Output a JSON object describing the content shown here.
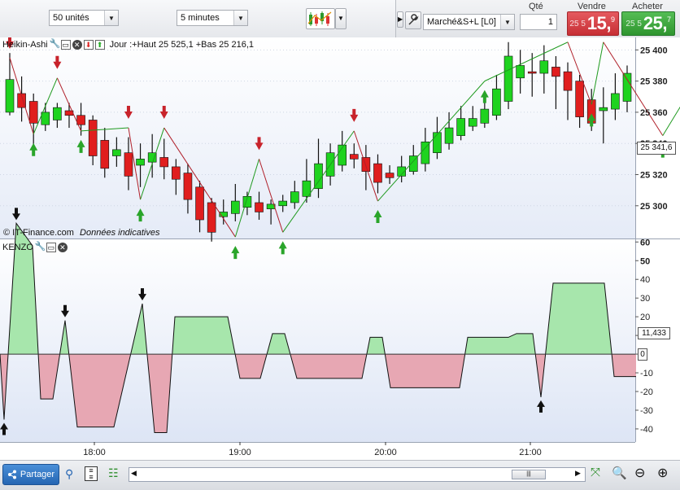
{
  "toolbar": {
    "quantity_select": "50 unités",
    "timeframe_select": "5 minutes",
    "qty_label": "Qté",
    "qty_value": "1",
    "sell_label": "Vendre",
    "buy_label": "Acheter",
    "order_type_select": "Marché&S+L [L0]",
    "sell_price_small": "25 5",
    "sell_price_big": "15,",
    "sell_price_sup": "9",
    "buy_price_small": "25 5",
    "buy_price_big": "25,",
    "buy_price_sup": "7",
    "colors": {
      "sell": "#d8393f",
      "buy": "#3aa63a"
    }
  },
  "price_panel": {
    "indicator_name": "Heikin-Ashi",
    "day_info": "Jour :+Haut 25 525,1 +Bas 25 216,1",
    "copyright": "© IT-Finance.com",
    "disclaimer": "Données indicatives",
    "current_price_label": "25 341,6"
  },
  "indicator_panel": {
    "name": "KENZO",
    "current_value_label": "11,433",
    "zero_label": "0"
  },
  "bottom": {
    "share_button": "Partager"
  },
  "chart_data": [
    {
      "type": "candlestick",
      "title": "Heikin-Ashi",
      "x_ticks": [
        "18:00",
        "19:00",
        "20:00",
        "21:00"
      ],
      "y_ticks": [
        25300,
        25320,
        25340,
        25360,
        25380,
        25400
      ],
      "ylim": [
        25279,
        25408
      ],
      "candles": [
        [
          25360,
          25381,
          25358,
          25398
        ],
        [
          25372,
          25363,
          25354,
          25383
        ],
        [
          25367,
          25353,
          25335,
          25372
        ],
        [
          25352,
          25360,
          25348,
          25366
        ],
        [
          25355,
          25363,
          25350,
          25366
        ],
        [
          25361,
          25358,
          25350,
          25366
        ],
        [
          25358,
          25352,
          25345,
          25366
        ],
        [
          25355,
          25332,
          25326,
          25358
        ],
        [
          25342,
          25324,
          25318,
          25350
        ],
        [
          25332,
          25336,
          25325,
          25344
        ],
        [
          25334,
          25319,
          25310,
          25344
        ],
        [
          25326,
          25330,
          25312,
          25340
        ],
        [
          25328,
          25334,
          25318,
          25346
        ],
        [
          25331,
          25325,
          25317,
          25343
        ],
        [
          25325,
          25317,
          25307,
          25330
        ],
        [
          25321,
          25304,
          25295,
          25327
        ],
        [
          25312,
          25291,
          25283,
          25316
        ],
        [
          25302,
          25283,
          25277,
          25305
        ],
        [
          25293,
          25296,
          25288,
          25304
        ],
        [
          25295,
          25303,
          25290,
          25314
        ],
        [
          25299,
          25306,
          25294,
          25309
        ],
        [
          25302,
          25296,
          25291,
          25309
        ],
        [
          25298,
          25301,
          25288,
          25304
        ],
        [
          25300,
          25303,
          25296,
          25307
        ],
        [
          25302,
          25309,
          25298,
          25316
        ],
        [
          25306,
          25316,
          25302,
          25330
        ],
        [
          25311,
          25327,
          25305,
          25343
        ],
        [
          25319,
          25334,
          25313,
          25340
        ],
        [
          25326,
          25339,
          25322,
          25348
        ],
        [
          25333,
          25330,
          25324,
          25340
        ],
        [
          25331,
          25322,
          25310,
          25339
        ],
        [
          25327,
          25315,
          25308,
          25333
        ],
        [
          25321,
          25318,
          25314,
          25326
        ],
        [
          25319,
          25325,
          25315,
          25332
        ],
        [
          25322,
          25332,
          25320,
          25339
        ],
        [
          25327,
          25341,
          25322,
          25350
        ],
        [
          25334,
          25347,
          25330,
          25357
        ],
        [
          25340,
          25350,
          25336,
          25360
        ],
        [
          25345,
          25356,
          25342,
          25364
        ],
        [
          25351,
          25356,
          25348,
          25364
        ],
        [
          25353,
          25362,
          25350,
          25368
        ],
        [
          25358,
          25375,
          25355,
          25384
        ],
        [
          25367,
          25396,
          25362,
          25405
        ],
        [
          25382,
          25390,
          25372,
          25400
        ],
        [
          25386,
          25385,
          25370,
          25398
        ],
        [
          25385,
          25393,
          25372,
          25403
        ],
        [
          25389,
          25383,
          25362,
          25396
        ],
        [
          25386,
          25374,
          25355,
          25392
        ],
        [
          25380,
          25357,
          25350,
          25384
        ],
        [
          25368,
          25353,
          25348,
          25375
        ],
        [
          25361,
          25363,
          25340,
          25376
        ],
        [
          25362,
          25372,
          25355,
          25385
        ],
        [
          25367,
          25385,
          25360,
          25390
        ]
      ],
      "zigzag": [
        [
          0,
          25395
        ],
        [
          2,
          25346
        ],
        [
          4,
          25382
        ],
        [
          6,
          25348
        ],
        [
          10,
          25350
        ],
        [
          11,
          25304
        ],
        [
          13,
          25350
        ],
        [
          19,
          25280
        ],
        [
          21,
          25330
        ],
        [
          23,
          25283
        ],
        [
          29,
          25348
        ],
        [
          31,
          25303
        ],
        [
          40,
          25380
        ],
        [
          47,
          25405
        ],
        [
          49,
          25365
        ],
        [
          50,
          25405
        ],
        [
          55,
          25345
        ],
        [
          59,
          25395
        ]
      ]
    },
    {
      "type": "area",
      "title": "KENZO",
      "y_ticks": [
        -40,
        -30,
        -20,
        -10,
        0,
        10,
        20,
        30,
        40,
        50,
        60
      ],
      "ylim": [
        -47,
        61
      ],
      "values": [
        [
          0,
          0
        ],
        [
          5,
          -35
        ],
        [
          20,
          70
        ],
        [
          40,
          58
        ],
        [
          50,
          -24
        ],
        [
          65,
          -24
        ],
        [
          80,
          18
        ],
        [
          95,
          -39
        ],
        [
          120,
          -39
        ],
        [
          140,
          -39
        ],
        [
          175,
          27
        ],
        [
          190,
          -42
        ],
        [
          205,
          -42
        ],
        [
          215,
          20
        ],
        [
          280,
          20
        ],
        [
          295,
          -13
        ],
        [
          320,
          -13
        ],
        [
          335,
          11
        ],
        [
          350,
          11
        ],
        [
          365,
          -13
        ],
        [
          445,
          -13
        ],
        [
          455,
          9
        ],
        [
          470,
          9
        ],
        [
          480,
          -18
        ],
        [
          565,
          -18
        ],
        [
          575,
          9
        ],
        [
          625,
          9
        ],
        [
          635,
          11
        ],
        [
          655,
          11
        ],
        [
          665,
          -23
        ],
        [
          680,
          38
        ],
        [
          743,
          38
        ],
        [
          755,
          -12
        ],
        [
          782,
          -12
        ]
      ]
    }
  ]
}
